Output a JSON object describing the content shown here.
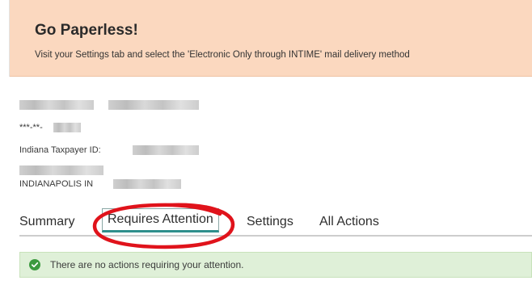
{
  "banner": {
    "title": "Go Paperless!",
    "message": "Visit your Settings tab and select the 'Electronic Only through INTIME' mail delivery method"
  },
  "account": {
    "masked_id": "***-**-",
    "taxpayer_id_label": "Indiana Taxpayer ID:",
    "city_state": "INDIANAPOLIS IN"
  },
  "tabs": [
    {
      "label": "Summary"
    },
    {
      "label": "Requires Attention",
      "active": true
    },
    {
      "label": "Settings"
    },
    {
      "label": "All Actions"
    }
  ],
  "alert": {
    "message": "There are no actions requiring your attention.",
    "icon": "check-circle-icon",
    "color": "#3c9a3f"
  },
  "colors": {
    "banner_bg": "#fbd8bf",
    "alert_bg": "#dff0d8",
    "active_tab_underline": "#2f8f8c",
    "annotation": "#e0131b"
  }
}
